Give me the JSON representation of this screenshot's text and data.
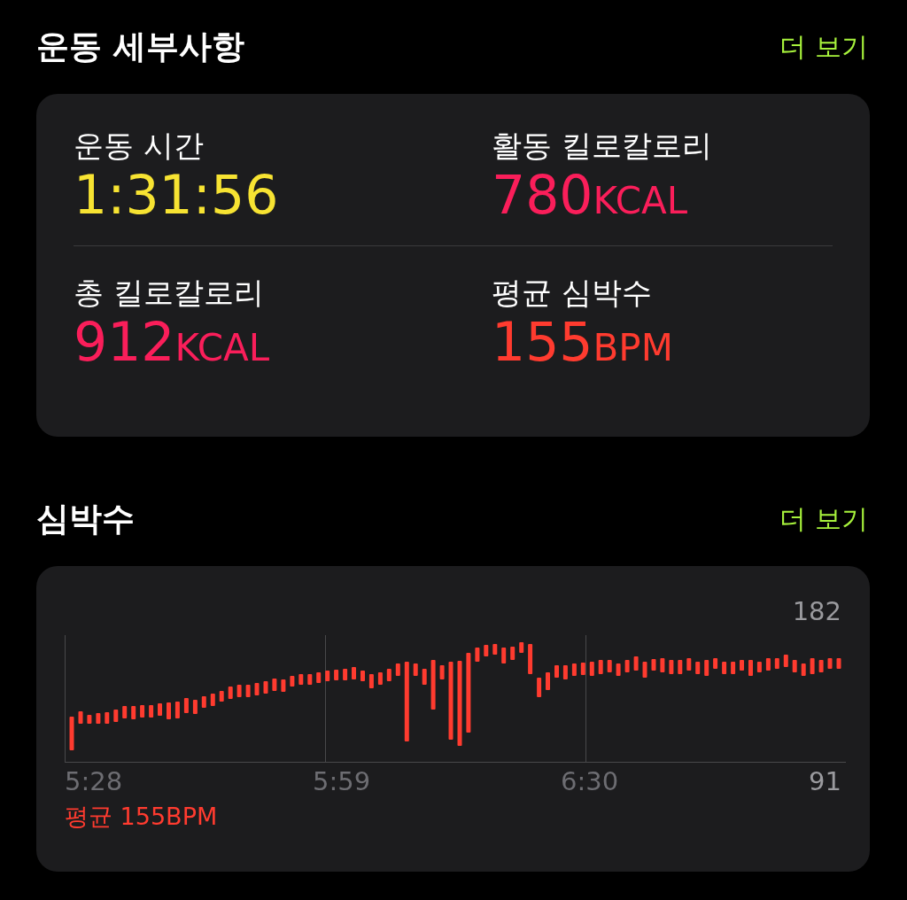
{
  "sections": [
    {
      "kind": "metrics",
      "title": "운동 세부사항",
      "more": "더 보기",
      "metrics": [
        {
          "label": "운동 시간",
          "value": "1:31:56",
          "color": "#f7e332"
        },
        {
          "label": "활동 킬로칼로리",
          "value": "780",
          "unit": "KCAL",
          "color": "#fa1e5a"
        },
        {
          "label": "총 킬로칼로리",
          "value": "912",
          "unit": "KCAL",
          "color": "#fa1e5a"
        },
        {
          "label": "평균 심박수",
          "value": "155",
          "unit": "BPM",
          "color": "#ff3b2f"
        }
      ]
    },
    {
      "kind": "chart",
      "title": "심박수",
      "more": "더 보기",
      "y_max": "182",
      "y_min": "91",
      "x_labels": [
        "5:28",
        "5:59",
        "6:30"
      ],
      "average": "평균 155BPM"
    }
  ]
}
